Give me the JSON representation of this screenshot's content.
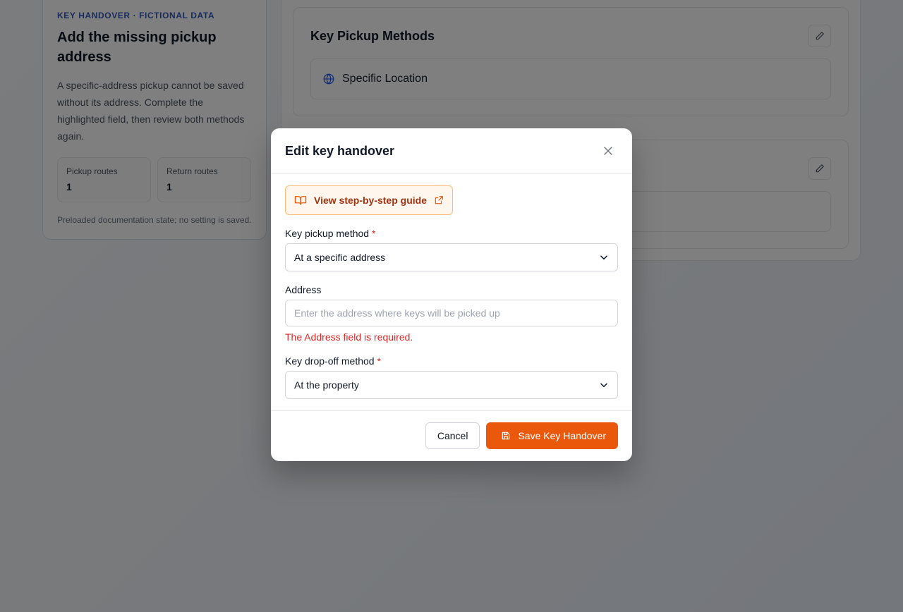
{
  "background": {
    "info_card": {
      "eyebrow": "KEY HANDOVER · FICTIONAL DATA",
      "title": "Add the missing pickup address",
      "description": "A specific-address pickup cannot be saved without its address. Complete the highlighted field, then review both methods again.",
      "stats": [
        {
          "label": "Pickup routes",
          "value": "1"
        },
        {
          "label": "Return routes",
          "value": "1"
        }
      ],
      "note": "Preloaded documentation state; no setting is saved."
    },
    "pickup_section": {
      "title": "Key Pickup Methods",
      "method": "Specific Location"
    }
  },
  "modal": {
    "title": "Edit key handover",
    "guide_label": "View step-by-step guide",
    "pickup": {
      "label": "Key pickup method",
      "required_mark": "*",
      "value": "At a specific address"
    },
    "address": {
      "label": "Address",
      "value": "",
      "placeholder": "Enter the address where keys will be picked up",
      "error": "The Address field is required."
    },
    "dropoff": {
      "label": "Key drop-off method",
      "required_mark": "*",
      "value": "At the property"
    },
    "cancel_label": "Cancel",
    "save_label": "Save Key Handover"
  },
  "colors": {
    "accent": "#ea580c",
    "error": "#dc2626",
    "eyebrow": "#3157b8"
  }
}
